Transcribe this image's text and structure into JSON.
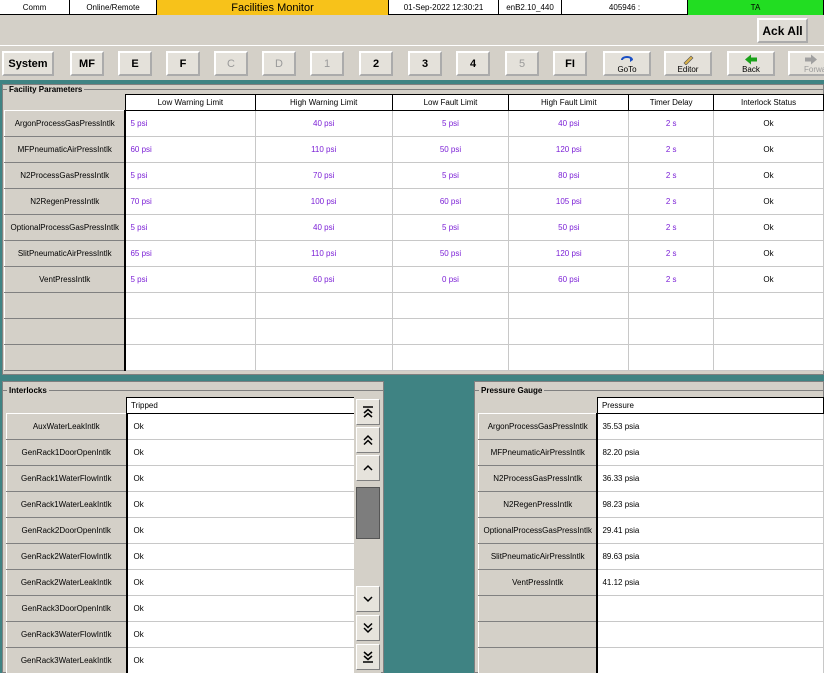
{
  "status_bar": {
    "comm": "Comm",
    "mode": "Online/Remote",
    "title": "Facilities Monitor",
    "datetime": "01-Sep-2022 12:30:21",
    "version": "enB2.10_440",
    "code": "405946 :",
    "ta": "TA"
  },
  "ack_all": "Ack All",
  "nav": {
    "system": "System",
    "mf": "MF",
    "e": "E",
    "f": "F",
    "c": "C",
    "d": "D",
    "n1": "1",
    "n2": "2",
    "n3": "3",
    "n4": "4",
    "n5": "5",
    "fi": "FI",
    "goto": "GoTo",
    "editor": "Editor",
    "back": "Back",
    "forward": "Forward"
  },
  "facility": {
    "title": "Facility Parameters",
    "columns": [
      "Low Warning Limit",
      "High Warning Limit",
      "Low Fault Limit",
      "High Fault Limit",
      "Timer Delay",
      "Interlock Status"
    ],
    "rows": [
      {
        "name": "ArgonProcessGasPressIntlk",
        "low_warn": "5 psi",
        "high_warn": "40 psi",
        "low_fault": "5 psi",
        "high_fault": "40 psi",
        "timer": "2 s",
        "status": "Ok"
      },
      {
        "name": "MFPneumaticAirPressIntlk",
        "low_warn": "60 psi",
        "high_warn": "110 psi",
        "low_fault": "50 psi",
        "high_fault": "120 psi",
        "timer": "2 s",
        "status": "Ok"
      },
      {
        "name": "N2ProcessGasPressIntlk",
        "low_warn": "5 psi",
        "high_warn": "70 psi",
        "low_fault": "5 psi",
        "high_fault": "80 psi",
        "timer": "2 s",
        "status": "Ok"
      },
      {
        "name": "N2RegenPressIntlk",
        "low_warn": "70 psi",
        "high_warn": "100 psi",
        "low_fault": "60 psi",
        "high_fault": "105 psi",
        "timer": "2 s",
        "status": "Ok"
      },
      {
        "name": "OptionalProcessGasPressIntlk",
        "low_warn": "5 psi",
        "high_warn": "40 psi",
        "low_fault": "5 psi",
        "high_fault": "50 psi",
        "timer": "2 s",
        "status": "Ok"
      },
      {
        "name": "SlitPneumaticAirPressIntlk",
        "low_warn": "65 psi",
        "high_warn": "110 psi",
        "low_fault": "50 psi",
        "high_fault": "120 psi",
        "timer": "2 s",
        "status": "Ok"
      },
      {
        "name": "VentPressIntlk",
        "low_warn": "5 psi",
        "high_warn": "60 psi",
        "low_fault": "0 psi",
        "high_fault": "60 psi",
        "timer": "2 s",
        "status": "Ok"
      }
    ]
  },
  "interlocks": {
    "title": "Interlocks",
    "column": "Tripped",
    "rows": [
      {
        "name": "AuxWaterLeakIntlk",
        "value": "Ok"
      },
      {
        "name": "GenRack1DoorOpenIntlk",
        "value": "Ok"
      },
      {
        "name": "GenRack1WaterFlowIntlk",
        "value": "Ok"
      },
      {
        "name": "GenRack1WaterLeakIntlk",
        "value": "Ok"
      },
      {
        "name": "GenRack2DoorOpenIntlk",
        "value": "Ok"
      },
      {
        "name": "GenRack2WaterFlowIntlk",
        "value": "Ok"
      },
      {
        "name": "GenRack2WaterLeakIntlk",
        "value": "Ok"
      },
      {
        "name": "GenRack3DoorOpenIntlk",
        "value": "Ok"
      },
      {
        "name": "GenRack3WaterFlowIntlk",
        "value": "Ok"
      },
      {
        "name": "GenRack3WaterLeakIntlk",
        "value": "Ok"
      }
    ]
  },
  "pressure": {
    "title": "Pressure Gauge",
    "column": "Pressure",
    "rows": [
      {
        "name": "ArgonProcessGasPressIntlk",
        "value": "35.53 psia"
      },
      {
        "name": "MFPneumaticAirPressIntlk",
        "value": "82.20 psia"
      },
      {
        "name": "N2ProcessGasPressIntlk",
        "value": "36.33 psia"
      },
      {
        "name": "N2RegenPressIntlk",
        "value": "98.23 psia"
      },
      {
        "name": "OptionalProcessGasPressIntlk",
        "value": "29.41 psia"
      },
      {
        "name": "SlitPneumaticAirPressIntlk",
        "value": "89.63 psia"
      },
      {
        "name": "VentPressIntlk",
        "value": "41.12 psia"
      }
    ]
  },
  "colors": {
    "title_bg": "#f7c21a",
    "ta_bg": "#22dd22",
    "background": "#3f8383",
    "value_text": "#7b1fd6"
  }
}
